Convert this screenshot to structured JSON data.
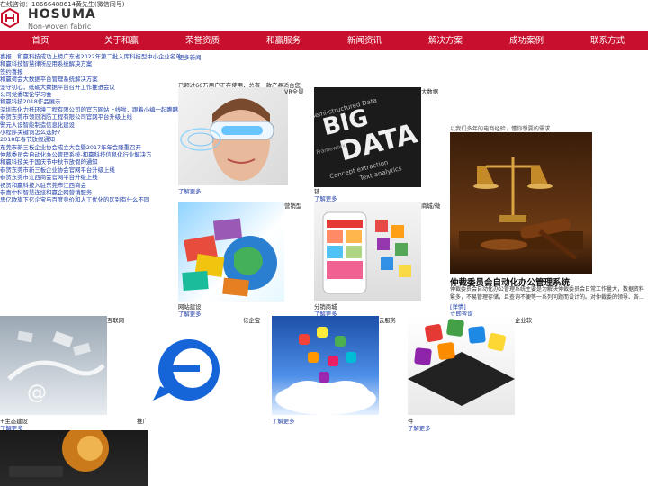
{
  "header": {
    "contact": "在线咨询：18666488614黄先生(微信同号)",
    "logo_name": "HOSUMA",
    "logo_sub": "Non-woven fabric"
  },
  "nav": [
    "首页",
    "关于和赢",
    "荣誉资质",
    "和赢服务",
    "新闻资讯",
    "解决方案",
    "成功案例",
    "联系方式"
  ],
  "news": {
    "more": "更多新闻",
    "items": [
      "喜报！和赢科技成功上榜广东省2022年第二批入库科技型中小企业名单",
      "和赢科技智慧律所应用系统解决方案",
      "签约喜报",
      "和赢荷会大数据平台管理系统解决方案",
      "坚守初心，砥砺大数据平台召开工作推进会议",
      "公司党委理论学习会",
      "和赢科技2018作品展示",
      "深圳市化力抵环境工程有限公司的官方网站上线啦，跟着小编一起瞧瞧吧！",
      "恭贺东莞市领冠消防工程有限公司官网平台升级上线",
      "警元人设智能制造信息化建设",
      "小程序关键词怎么选好?",
      "2018年春节放假通知",
      "东莞市新三板企业协会成立大会暨2017年年会隆重召开",
      "仲裁委员会自动化办公管理系统-和赢科技信息化行业解决方",
      "和赢科技关于国庆节中秋节放假的通知",
      "恭贺东莞市新三板企业协会官网平台升级上线",
      "恭贺东莞市江西商会官网平台升级上线",
      "祝贺和赢科技入驻东莞市江西商会",
      "恭喜中科智慧连接和赢企网营销服务",
      "思亿欧旗下亿企宝与百度竞价和人工优化的区别有什么不同"
    ]
  },
  "intro": "已超过60万用户正在使用，总有一款产品适合您",
  "cards": [
    {
      "title": "VR全景",
      "more": "了解更多"
    },
    {
      "title": "大数据",
      "more": "了解更多"
    },
    {
      "title": "营销型",
      "more": "了解更多"
    },
    {
      "title": "商城/微",
      "more": "了解更多"
    }
  ],
  "side_texts": {
    "network_build": "网站建设",
    "distribution_mall": "分销商城",
    "shop": "铺"
  },
  "experience_text": "以我们多年的电商经验，懂你想要的需求",
  "feature": {
    "title": "仲裁委员会自动化办公管理系统",
    "desc": "仲裁委员会自动化办公管理系统主要是为解决仲裁委员会日常工作量大，数据资料繁多，不易管理存储，且查询不便等一系列问题而设计的。对仲裁委的领导、各...",
    "detail": "[详情]",
    "consult": "立即咨询"
  },
  "bottom_cards": [
    {
      "title": "互联网",
      "caption": "+生态建设",
      "more": "了解更多"
    },
    {
      "title": "亿企宝",
      "caption": "推广",
      "more": ""
    },
    {
      "title": "云服务",
      "caption": "",
      "more": "了解更多"
    },
    {
      "title": "企业软",
      "caption": "件",
      "more": "了解更多"
    }
  ]
}
